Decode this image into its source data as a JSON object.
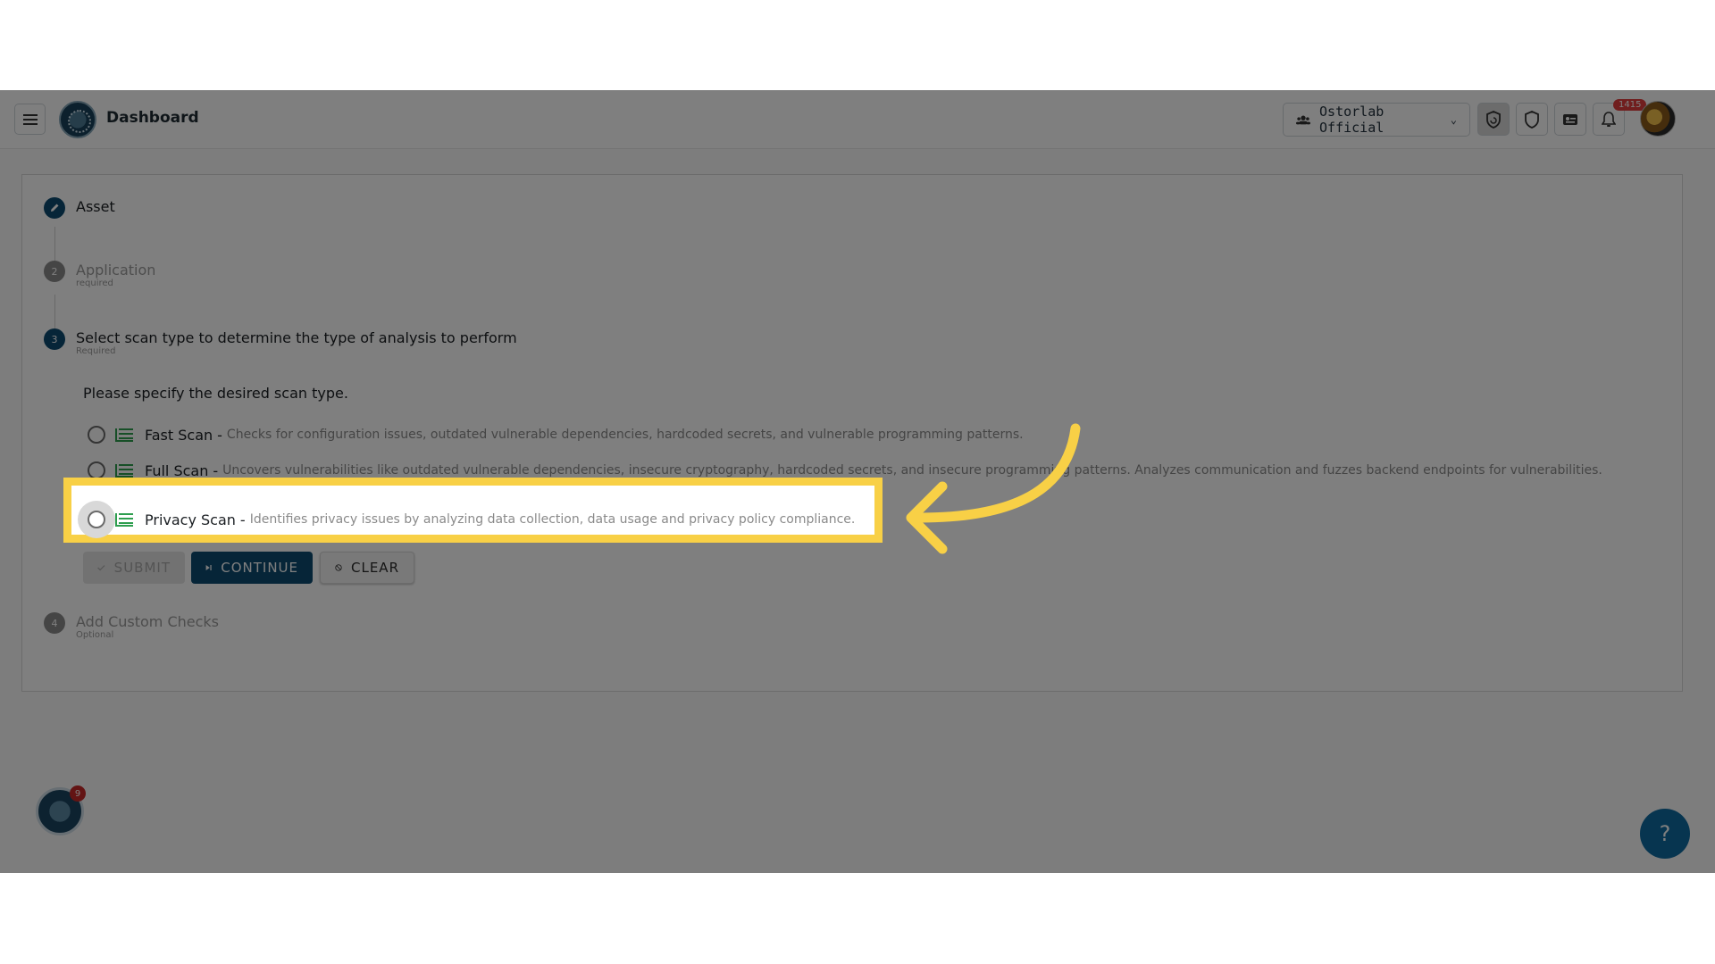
{
  "header": {
    "title": "Dashboard",
    "org": "Ostorlab Official",
    "notifications_count": "1415"
  },
  "steps": [
    {
      "number": "",
      "label": "Asset",
      "sub": ""
    },
    {
      "number": "2",
      "label": "Application",
      "sub": "required"
    },
    {
      "number": "3",
      "label": "Select scan type to determine the type of analysis to perform",
      "sub": "Required"
    },
    {
      "number": "4",
      "label": "Add Custom Checks",
      "sub": "Optional"
    }
  ],
  "prompt": "Please specify the desired scan type.",
  "options": [
    {
      "name": "Fast Scan",
      "dash": "-",
      "desc": "Checks for configuration issues, outdated vulnerable dependencies, hardcoded secrets, and vulnerable programming patterns."
    },
    {
      "name": "Full Scan",
      "dash": "-",
      "desc": "Uncovers vulnerabilities like outdated vulnerable dependencies, insecure cryptography, hardcoded secrets, and insecure programming patterns. Analyzes communication and fuzzes backend endpoints for vulnerabilities."
    },
    {
      "name": "Privacy Scan",
      "dash": "-",
      "desc": "Identifies privacy issues by analyzing data collection, data usage and privacy policy compliance."
    }
  ],
  "buttons": {
    "submit": "SUBMIT",
    "continue": "CONTINUE",
    "clear": "CLEAR"
  },
  "chat_badge": "9",
  "help": "?",
  "colors": {
    "primary": "#0d4b70",
    "highlight": "#f8d046",
    "scan_icon": "#2e9e4f"
  }
}
